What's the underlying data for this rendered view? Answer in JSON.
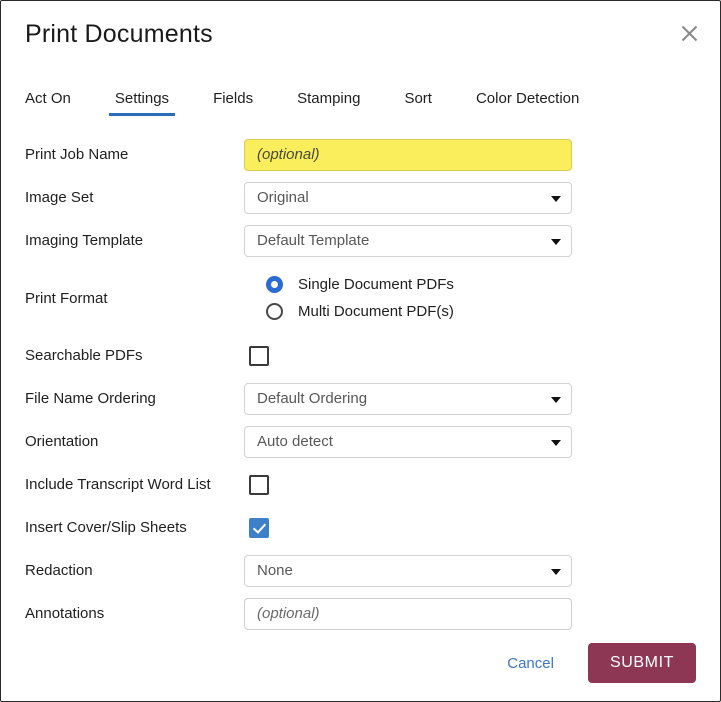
{
  "dialog": {
    "title": "Print Documents",
    "close_icon": "close-x-icon"
  },
  "tabs": [
    {
      "label": "Act On",
      "active": false
    },
    {
      "label": "Settings",
      "active": true
    },
    {
      "label": "Fields",
      "active": false
    },
    {
      "label": "Stamping",
      "active": false
    },
    {
      "label": "Sort",
      "active": false
    },
    {
      "label": "Color Detection",
      "active": false
    }
  ],
  "fields": {
    "print_job_name": {
      "label": "Print Job Name",
      "value": "",
      "placeholder": "(optional)"
    },
    "image_set": {
      "label": "Image Set",
      "value": "Original"
    },
    "imaging_template": {
      "label": "Imaging Template",
      "value": "Default Template"
    },
    "print_format": {
      "label": "Print Format",
      "options": [
        {
          "label": "Single Document PDFs",
          "selected": true
        },
        {
          "label": "Multi Document PDF(s)",
          "selected": false
        }
      ]
    },
    "searchable_pdfs": {
      "label": "Searchable PDFs",
      "checked": false
    },
    "file_name_ordering": {
      "label": "File Name Ordering",
      "value": "Default Ordering"
    },
    "orientation": {
      "label": "Orientation",
      "value": "Auto detect"
    },
    "include_transcript_word_list": {
      "label": "Include Transcript Word List",
      "checked": false
    },
    "insert_cover_slip_sheets": {
      "label": "Insert Cover/Slip Sheets",
      "checked": true
    },
    "redaction": {
      "label": "Redaction",
      "value": "None"
    },
    "annotations": {
      "label": "Annotations",
      "value": "",
      "placeholder": "(optional)"
    }
  },
  "footer": {
    "cancel_label": "Cancel",
    "submit_label": "SUBMIT"
  },
  "colors": {
    "accent_blue": "#2b6cb8",
    "submit_maroon": "#8e3755",
    "highlight_yellow": "#fbee5c",
    "link_blue": "#3f76c4",
    "checkbox_blue": "#3e80c8"
  }
}
